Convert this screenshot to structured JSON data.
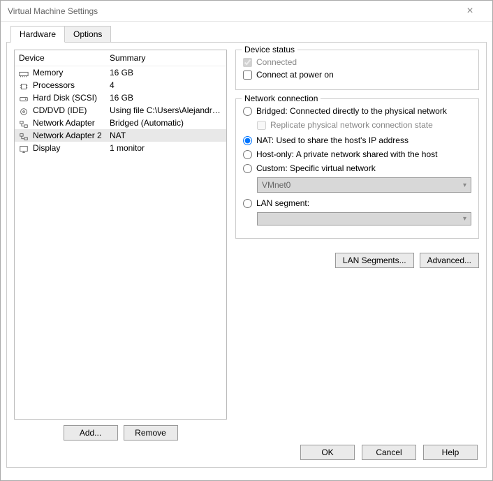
{
  "window": {
    "title": "Virtual Machine Settings"
  },
  "tabs": {
    "hardware": "Hardware",
    "options": "Options"
  },
  "device_list": {
    "header_device": "Device",
    "header_summary": "Summary",
    "rows": [
      {
        "icon": "memory-icon",
        "label": "Memory",
        "summary": "16 GB",
        "selected": false
      },
      {
        "icon": "processor-icon",
        "label": "Processors",
        "summary": "4",
        "selected": false
      },
      {
        "icon": "disk-icon",
        "label": "Hard Disk (SCSI)",
        "summary": "16 GB",
        "selected": false
      },
      {
        "icon": "cd-icon",
        "label": "CD/DVD (IDE)",
        "summary": "Using file C:\\Users\\Alejandro...",
        "selected": false
      },
      {
        "icon": "network-icon",
        "label": "Network Adapter",
        "summary": "Bridged (Automatic)",
        "selected": false
      },
      {
        "icon": "network-icon",
        "label": "Network Adapter 2",
        "summary": "NAT",
        "selected": true
      },
      {
        "icon": "display-icon",
        "label": "Display",
        "summary": "1 monitor",
        "selected": false
      }
    ]
  },
  "left_buttons": {
    "add": "Add...",
    "remove": "Remove"
  },
  "device_status": {
    "title": "Device status",
    "connected": "Connected",
    "connect_power": "Connect at power on"
  },
  "network": {
    "title": "Network connection",
    "bridged": "Bridged: Connected directly to the physical network",
    "replicate": "Replicate physical network connection state",
    "nat": "NAT: Used to share the host's IP address",
    "hostonly": "Host-only: A private network shared with the host",
    "custom": "Custom: Specific virtual network",
    "custom_value": "VMnet0",
    "lan": "LAN segment:",
    "lan_value": ""
  },
  "right_buttons": {
    "lan_segments": "LAN Segments...",
    "advanced": "Advanced..."
  },
  "footer": {
    "ok": "OK",
    "cancel": "Cancel",
    "help": "Help"
  }
}
